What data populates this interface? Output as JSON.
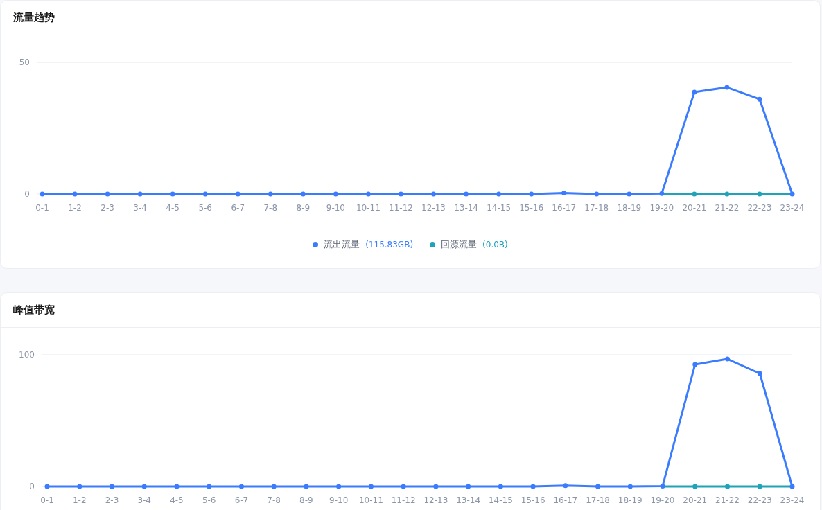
{
  "cards": [
    {
      "title": "流量趋势",
      "chart_data": {
        "type": "line",
        "categories": [
          "0-1",
          "1-2",
          "2-3",
          "3-4",
          "4-5",
          "5-6",
          "6-7",
          "7-8",
          "8-9",
          "9-10",
          "10-11",
          "11-12",
          "12-13",
          "13-14",
          "14-15",
          "15-16",
          "16-17",
          "17-18",
          "18-19",
          "19-20",
          "20-21",
          "21-22",
          "22-23",
          "23-24"
        ],
        "ylim": [
          0,
          50
        ],
        "yticks": [
          0,
          50
        ],
        "series": [
          {
            "name": "流出流量",
            "color": "#3b7cff",
            "marker": "circle",
            "values": [
              0,
              0,
              0,
              0,
              0,
              0,
              0,
              0,
              0,
              0,
              0,
              0,
              0,
              0,
              0,
              0,
              0.4,
              0,
              0,
              0.2,
              38.7,
              40.5,
              36,
              0
            ]
          },
          {
            "name": "回源流量",
            "color": "#1fa3b8",
            "marker": "circle",
            "values": [
              null,
              null,
              null,
              null,
              null,
              null,
              null,
              null,
              null,
              null,
              null,
              null,
              null,
              null,
              null,
              null,
              null,
              null,
              null,
              0,
              0,
              0,
              0,
              0
            ]
          }
        ]
      },
      "legend": [
        {
          "value": "(115.83GB)"
        },
        {
          "value": "(0.0B)"
        }
      ]
    },
    {
      "title": "峰值带宽",
      "chart_data": {
        "type": "line",
        "categories": [
          "0-1",
          "1-2",
          "2-3",
          "3-4",
          "4-5",
          "5-6",
          "6-7",
          "7-8",
          "8-9",
          "9-10",
          "10-11",
          "11-12",
          "12-13",
          "13-14",
          "14-15",
          "15-16",
          "16-17",
          "17-18",
          "18-19",
          "19-20",
          "20-21",
          "21-22",
          "22-23",
          "23-24"
        ],
        "ylim": [
          0,
          100
        ],
        "yticks": [
          0,
          100
        ],
        "series": [
          {
            "color": "#3b7cff",
            "marker": "circle",
            "values": [
              0,
              0,
              0,
              0,
              0,
              0,
              0,
              0,
              0,
              0,
              0,
              0,
              0,
              0,
              0,
              0,
              0.7,
              0,
              0,
              0.3,
              92.6,
              96.8,
              85.8,
              0
            ]
          },
          {
            "color": "#1fa3b8",
            "marker": "circle",
            "values": [
              null,
              null,
              null,
              null,
              null,
              null,
              null,
              null,
              null,
              null,
              null,
              null,
              null,
              null,
              null,
              null,
              null,
              null,
              null,
              0,
              0,
              0,
              0,
              0
            ]
          }
        ]
      }
    }
  ]
}
